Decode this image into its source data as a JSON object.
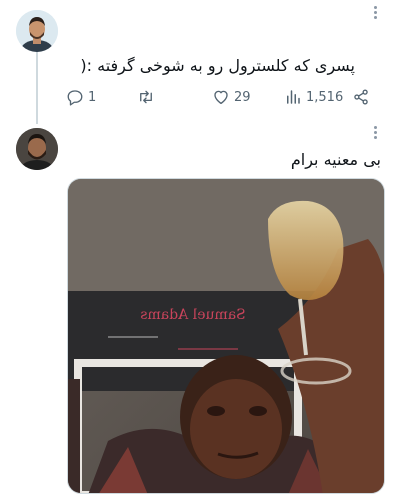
{
  "tweets": [
    {
      "text": "پسری که کلسترول رو به شوخی گرفته :(",
      "actions": {
        "replies": "1",
        "likes": "29",
        "views": "1,516"
      }
    },
    {
      "text": "بی معنیه برام",
      "media": {
        "chalkboard_text": "Samuel Adams"
      }
    }
  ],
  "colors": {
    "icon_gray": "#536471",
    "thread_line": "#cfd9de"
  }
}
